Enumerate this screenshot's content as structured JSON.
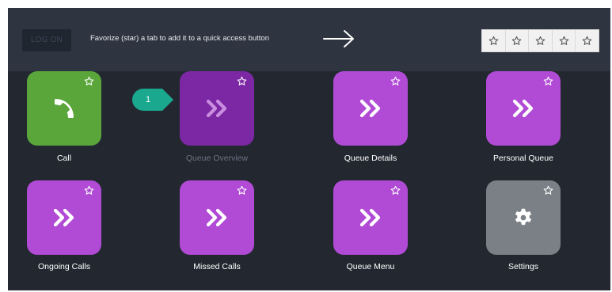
{
  "topbar": {
    "logon_label": "LOG ON",
    "hint_text": "Favorize (star) a tab to add it to a quick access button",
    "quick_access_slots": [
      "star-icon",
      "star-icon",
      "star-icon",
      "star-icon",
      "star-icon"
    ]
  },
  "callout": {
    "number": "1",
    "color": "#1aa88f"
  },
  "tiles": [
    {
      "label": "Call",
      "icon": "phone-icon",
      "color": "#5aa63a"
    },
    {
      "label": "Queue Overview",
      "icon": "chevron-double-right-icon",
      "color": "#7c27a3",
      "state": "selected"
    },
    {
      "label": "Queue Details",
      "icon": "chevron-double-right-icon",
      "color": "#b14bd6"
    },
    {
      "label": "Personal Queue",
      "icon": "chevron-double-right-icon",
      "color": "#b14bd6"
    },
    {
      "label": "Ongoing Calls",
      "icon": "chevron-double-right-icon",
      "color": "#b14bd6"
    },
    {
      "label": "Missed Calls",
      "icon": "chevron-double-right-icon",
      "color": "#b14bd6"
    },
    {
      "label": "Queue Menu",
      "icon": "chevron-double-right-icon",
      "color": "#b14bd6"
    },
    {
      "label": "Settings",
      "icon": "gear-icon",
      "color": "#7b8086"
    }
  ]
}
